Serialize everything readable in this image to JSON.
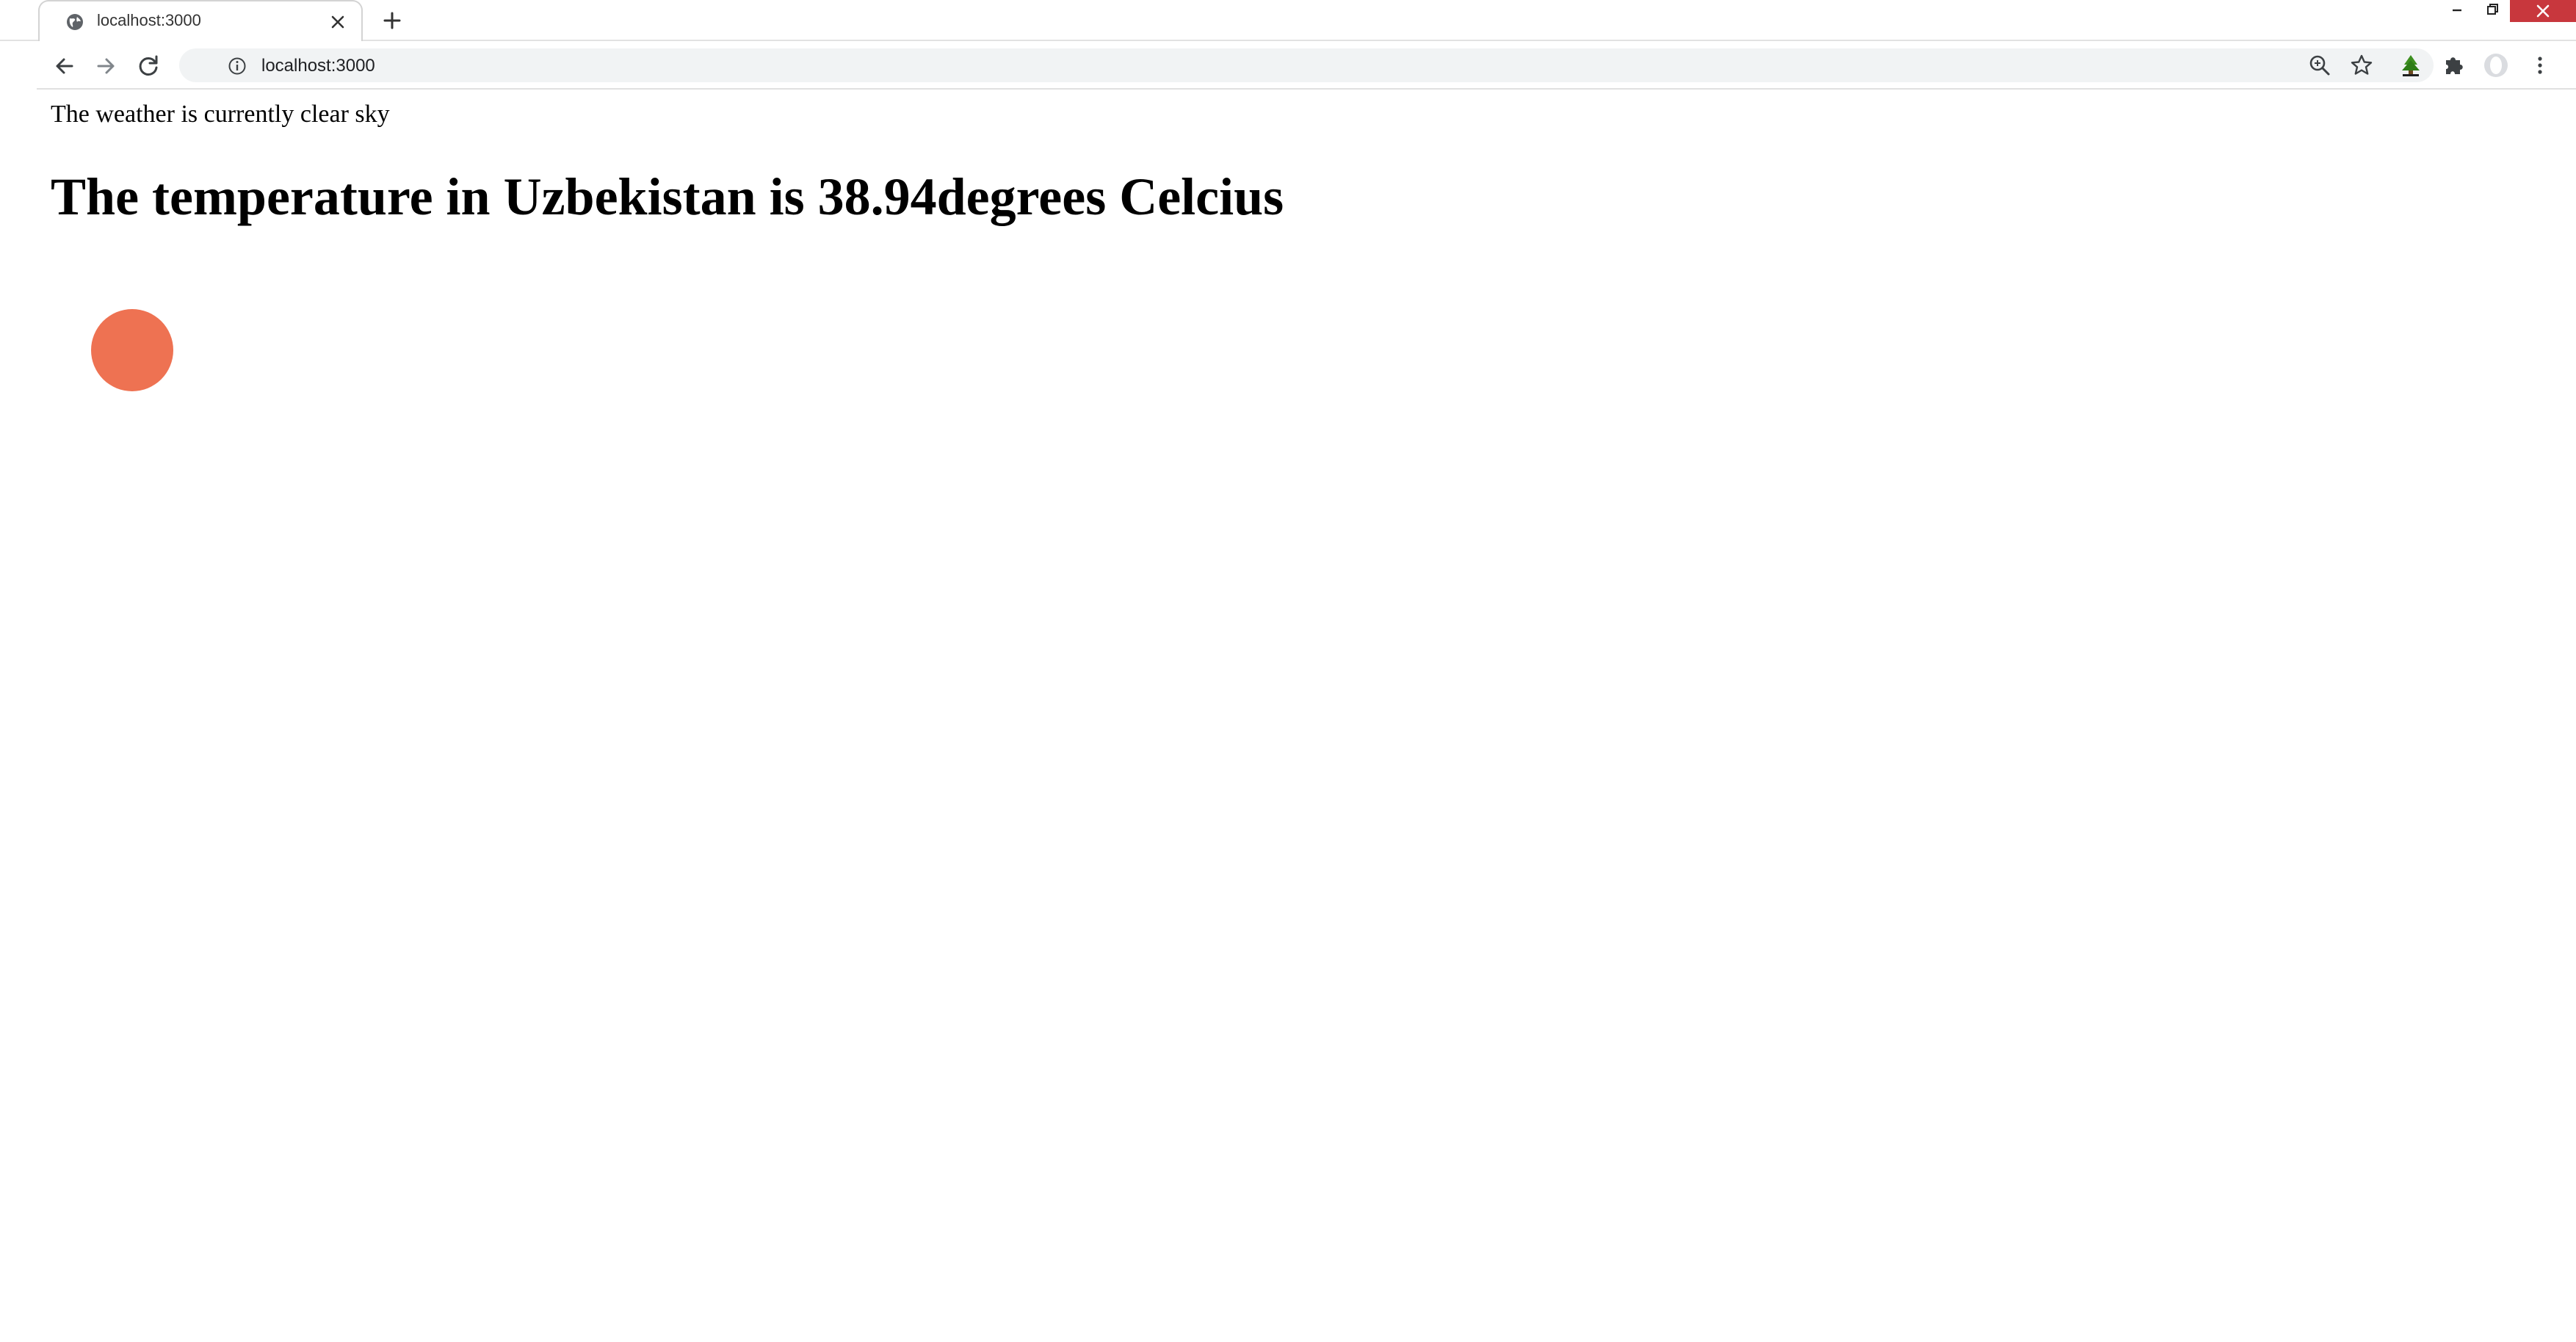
{
  "browser": {
    "tab": {
      "title": "localhost:3000",
      "favicon": "globe-icon",
      "close_icon": "close-icon"
    },
    "new_tab_icon": "plus-icon",
    "window_controls": [
      "minimize-icon",
      "restore-icon",
      "close-icon"
    ],
    "toolbar": {
      "back_icon": "arrow-left-icon",
      "forward_icon": "arrow-right-icon",
      "reload_icon": "reload-icon",
      "site_info_icon": "info-icon",
      "url": "localhost:3000",
      "right_icons": [
        "zoom-icon",
        "star-icon",
        "extension-tree-icon",
        "puzzle-icon",
        "profile-avatar",
        "kebab-menu-icon"
      ]
    },
    "colors": {
      "close_button": "#c8373d",
      "omnibox_bg": "#f1f3f4"
    }
  },
  "page": {
    "weather_description": "The weather is currently clear sky",
    "temperature_heading": "The temperature in Uzbekistan is 38.94degrees Celcius",
    "weather_icon": {
      "name": "weather-image",
      "color": "#ee7252"
    }
  }
}
